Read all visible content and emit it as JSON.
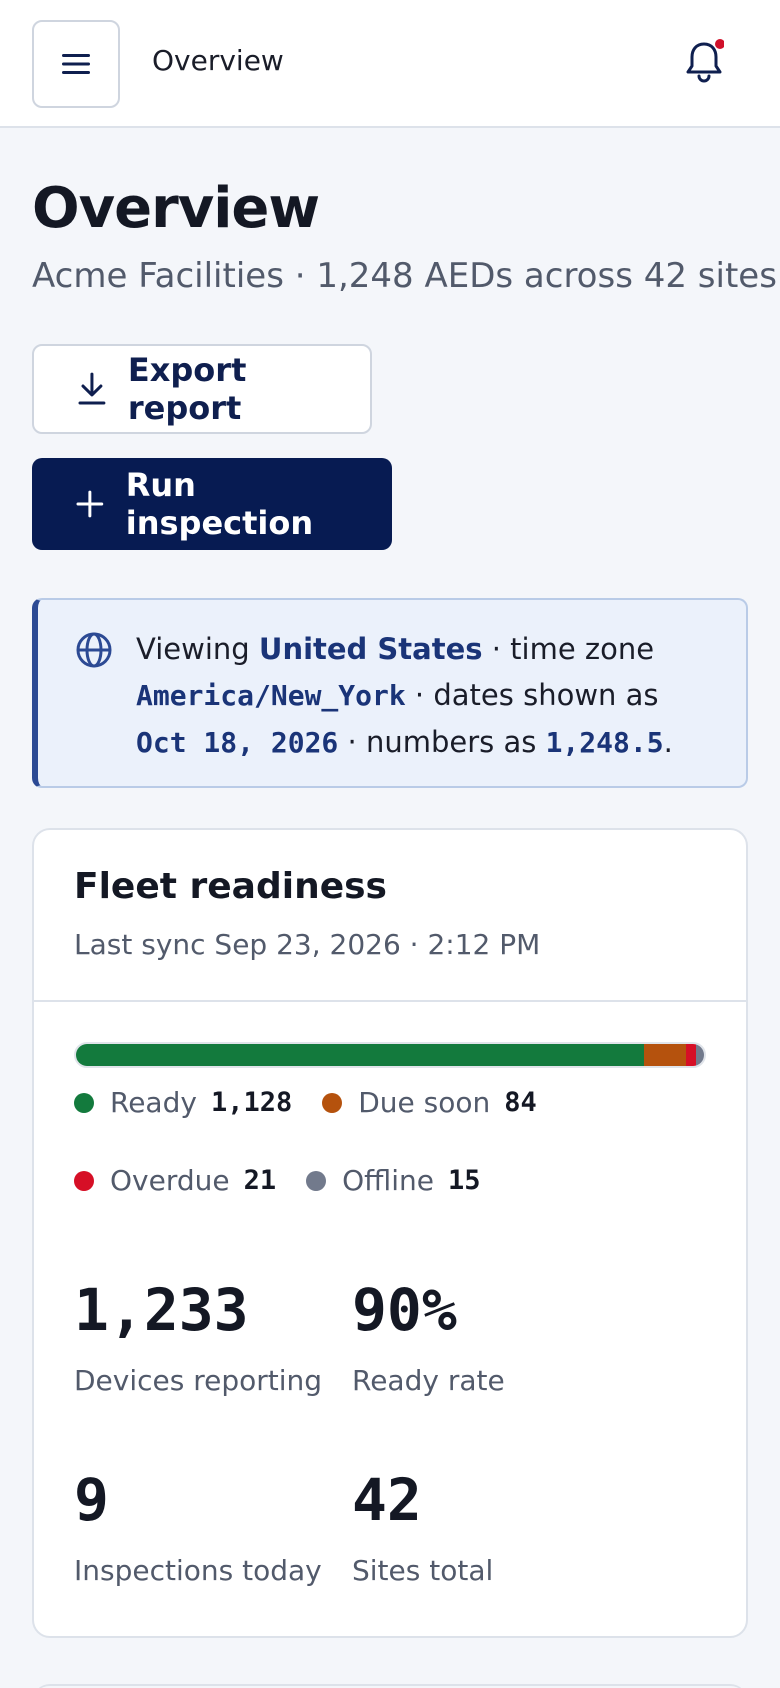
{
  "topbar": {
    "title": "Overview",
    "menu_icon": "hamburger-icon",
    "notification_icon": "bell-icon",
    "notification_dot_color": "#d0102a"
  },
  "page": {
    "title": "Overview",
    "subtitle": "Acme Facilities · 1,248 AEDs across 42 sites"
  },
  "actions": {
    "export_label": "Export report",
    "export_icon": "download-icon",
    "run_label": "Run inspection",
    "run_icon": "plus-icon"
  },
  "locale": {
    "icon": "globe-icon",
    "viewing_prefix": "Viewing ",
    "country": "United States",
    "tz_prefix": " · time zone ",
    "timezone": "America/New_York",
    "dates_prefix": " · dates shown as ",
    "date_sample": "Oct 18, 2026",
    "numbers_prefix": " · numbers as ",
    "number_sample": "1,248.5",
    "suffix": "."
  },
  "fleet": {
    "title": "Fleet readiness",
    "last_sync": "Last sync Sep 23, 2026 · 2:12 PM",
    "total": 1248,
    "segments": [
      {
        "label": "Ready",
        "count": "1,128",
        "value": 1128,
        "color": "#137a3d"
      },
      {
        "label": "Due soon",
        "count": "84",
        "value": 84,
        "color": "#b5520d"
      },
      {
        "label": "Overdue",
        "count": "21",
        "value": 21,
        "color": "#d60f26"
      },
      {
        "label": "Offline",
        "count": "15",
        "value": 15,
        "color": "#727a8c"
      }
    ],
    "stats": [
      {
        "value": "1,233",
        "label": "Devices reporting"
      },
      {
        "value": "90%",
        "label": "Ready rate"
      },
      {
        "value": "9",
        "label": "Inspections today"
      },
      {
        "value": "42",
        "label": "Sites total"
      }
    ]
  }
}
